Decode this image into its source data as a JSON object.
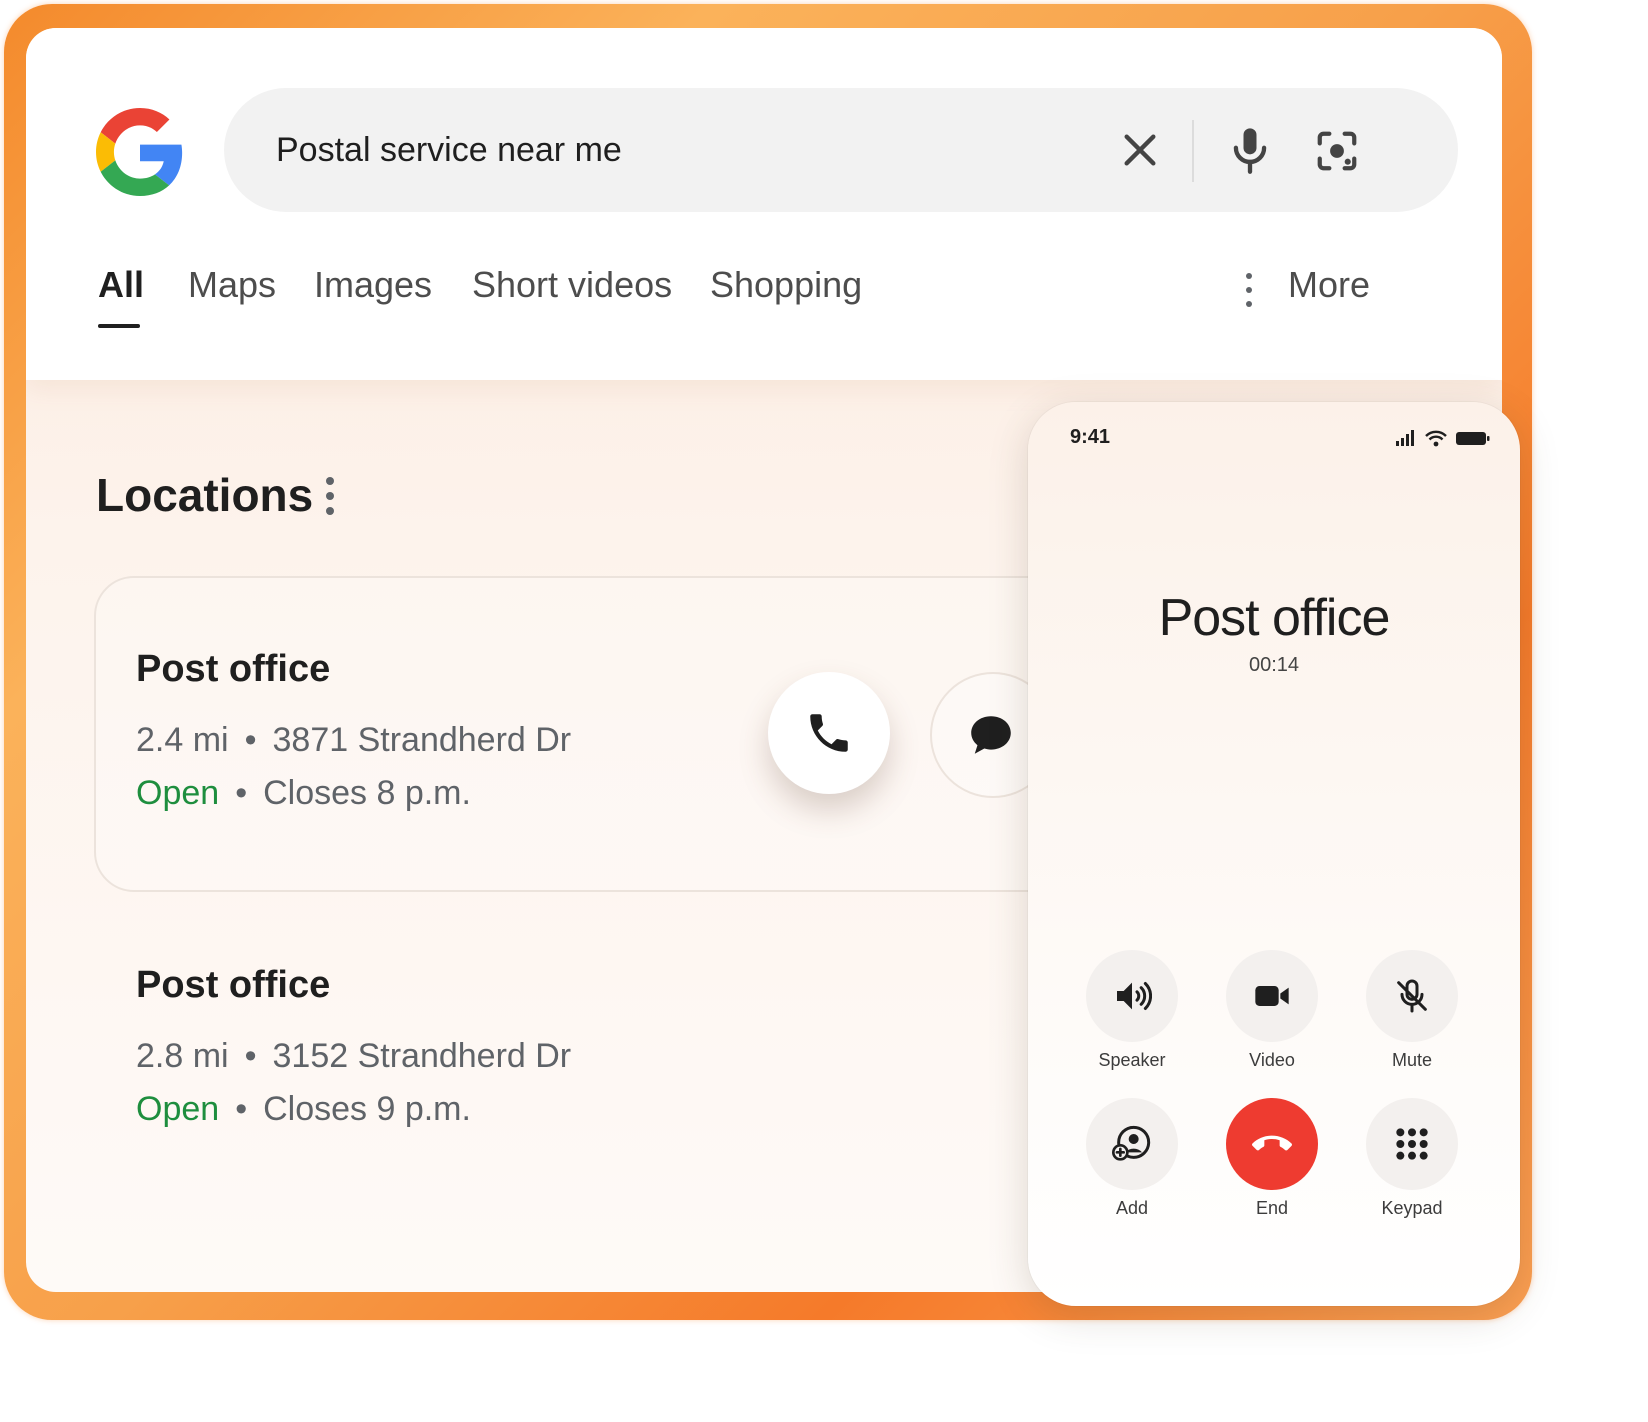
{
  "search": {
    "query": "Postal service near me"
  },
  "tabs": [
    {
      "label": "All",
      "active": true
    },
    {
      "label": "Maps"
    },
    {
      "label": "Images"
    },
    {
      "label": "Short videos"
    },
    {
      "label": "Shopping"
    }
  ],
  "more_label": "More",
  "locations": {
    "title": "Locations",
    "results": [
      {
        "name": "Post office",
        "distance": "2.4 mi",
        "address": "3871  Strandherd Dr",
        "status": "Open",
        "closes": "Closes 8 p.m."
      },
      {
        "name": "Post office",
        "distance": "2.8 mi",
        "address": "3152  Strandherd Dr",
        "status": "Open",
        "closes": "Closes 9 p.m."
      }
    ]
  },
  "phone": {
    "time": "9:41",
    "caller": "Post office",
    "timer": "00:14",
    "buttons": [
      {
        "label": "Speaker",
        "icon": "speaker-icon"
      },
      {
        "label": "Video",
        "icon": "video-icon"
      },
      {
        "label": "Mute",
        "icon": "mic-off-icon"
      },
      {
        "label": "Add",
        "icon": "add-person-icon"
      },
      {
        "label": "End",
        "icon": "end-call-icon"
      },
      {
        "label": "Keypad",
        "icon": "keypad-icon"
      }
    ]
  },
  "colors": {
    "open_green": "#1e8e3e",
    "end_red": "#ee3b30",
    "frame_orange": "#f48a2c"
  },
  "separator": "•"
}
